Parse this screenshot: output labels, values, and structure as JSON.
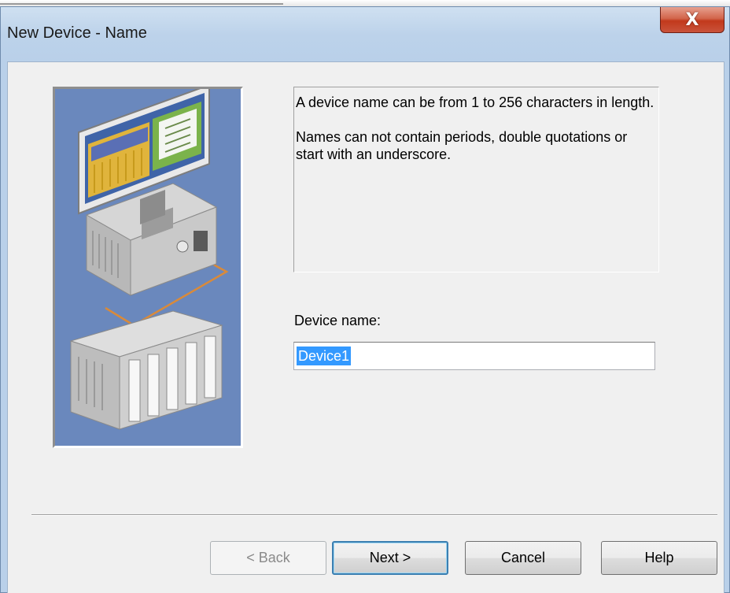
{
  "window": {
    "title": "New Device - Name",
    "close_icon": "close-x-icon",
    "close_glyph": "X"
  },
  "info": {
    "paragraph1": "A device name can be from 1 to 256 characters in length.",
    "paragraph2": "Names can not contain periods, double quotations or start with an underscore."
  },
  "form": {
    "device_name_label": "Device name:",
    "device_name_value": "Device1"
  },
  "buttons": {
    "back": "< Back",
    "next": "Next >",
    "cancel": "Cancel",
    "help": "Help"
  },
  "illustration": {
    "icon": "computer-and-plc-illustration",
    "colors": {
      "background": "#6a88bd",
      "cable": "#d98a3a"
    }
  }
}
